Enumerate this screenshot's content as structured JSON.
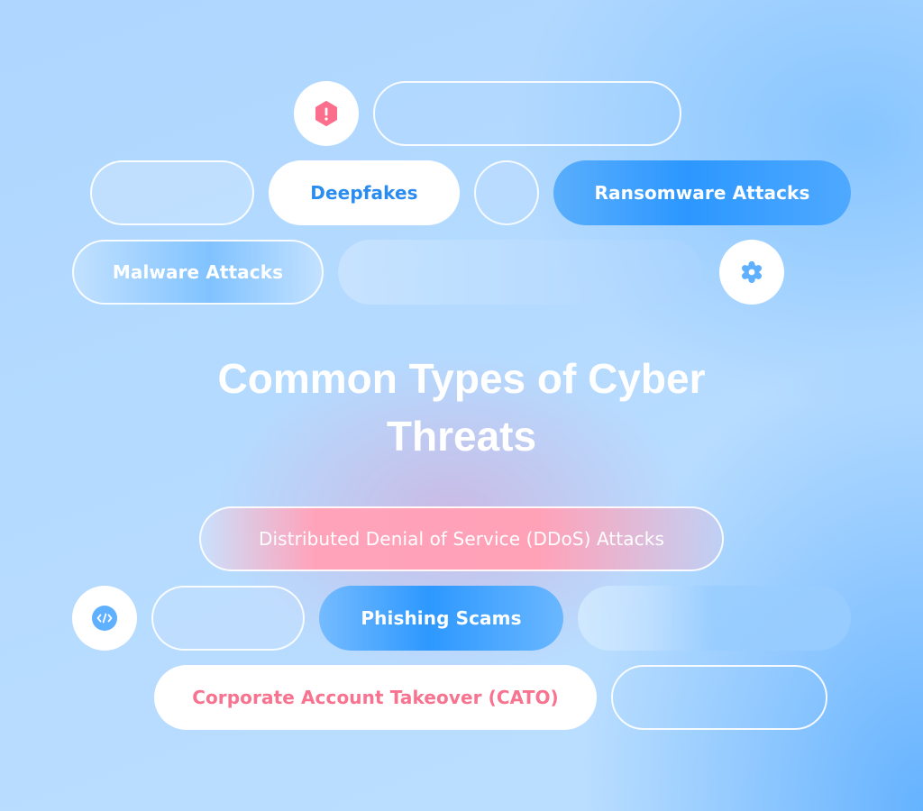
{
  "title": {
    "line1": "Common Types of Cyber",
    "line2": "Threats"
  },
  "icons": {
    "alert": "alert-hexagon-icon",
    "settings": "gear-icon",
    "code": "code-brackets-icon"
  },
  "threats": [
    {
      "label": "Deepfakes"
    },
    {
      "label": "Ransomware Attacks"
    },
    {
      "label": "Malware Attacks"
    },
    {
      "label": "Distributed Denial of Service (DDoS) Attacks"
    },
    {
      "label": "Phishing Scams"
    },
    {
      "label": "Corporate Account Takeover (CATO)"
    }
  ],
  "colors": {
    "accent_blue": "#2c97ff",
    "accent_pink": "#f7738f",
    "deepfakes_text": "#2a8cf0",
    "alert_icon": "#fb6f8c",
    "icon_blue": "#5fb0ff"
  }
}
